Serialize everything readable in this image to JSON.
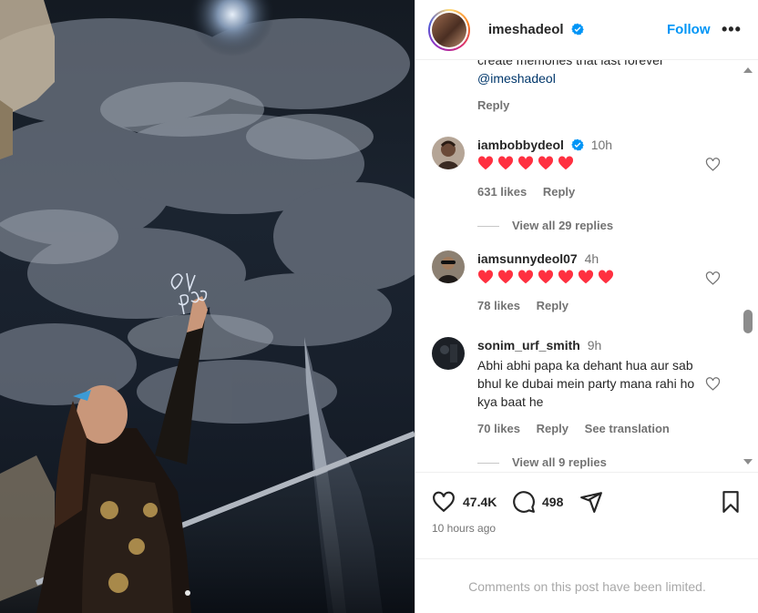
{
  "post": {
    "username": "imeshadeol",
    "follow_label": "Follow",
    "more_label": "•••"
  },
  "comments_top": {
    "clipped_text": "create memories that last forever",
    "mention": "@imeshadeol",
    "reply_label": "Reply"
  },
  "comments": [
    {
      "username": "iambobbydeol",
      "verified": true,
      "time": "10h",
      "heart_count": 5,
      "text": "",
      "likes": "631 likes",
      "reply_label": "Reply",
      "translation_label": "",
      "view_replies": "View all 29 replies"
    },
    {
      "username": "iamsunnydeol07",
      "verified": false,
      "time": "4h",
      "heart_count": 7,
      "text": "",
      "likes": "78 likes",
      "reply_label": "Reply",
      "translation_label": "",
      "view_replies": ""
    },
    {
      "username": "sonim_urf_smith",
      "verified": false,
      "time": "9h",
      "heart_count": 0,
      "text": "Abhi abhi papa ka dehant hua aur sab bhul ke dubai mein party mana rahi ho kya baat he",
      "likes": "70 likes",
      "reply_label": "Reply",
      "translation_label": "See translation",
      "view_replies": "View all 9 replies"
    }
  ],
  "actions": {
    "like_count": "47.4K",
    "comment_count": "498",
    "posted_ago": "10 hours ago"
  },
  "footer": {
    "limited_text": "Comments on this post have been limited."
  },
  "colors": {
    "accent": "#0095f6",
    "verified": "#0095f6",
    "heart": "#ff3040",
    "muted": "#737373"
  },
  "photo": {
    "handwriting": "U Papa"
  }
}
